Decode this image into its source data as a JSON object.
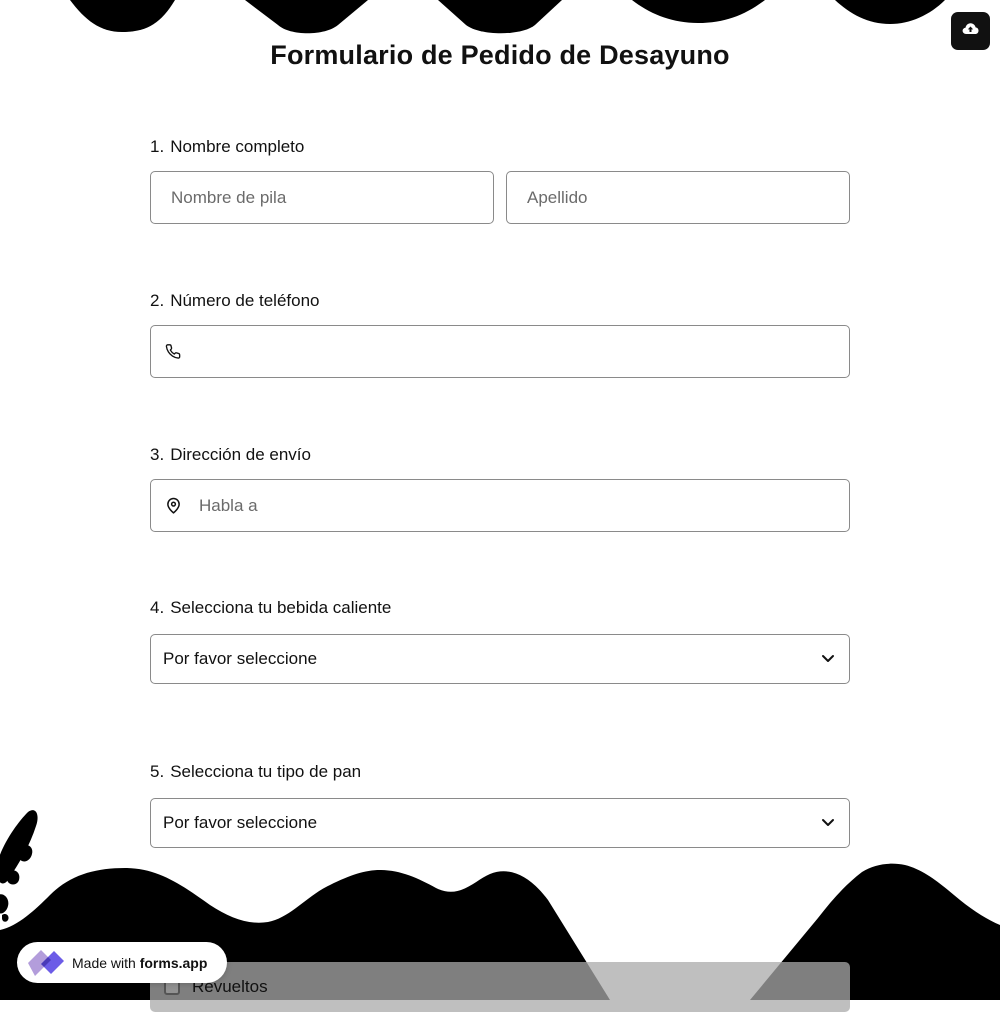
{
  "form": {
    "title": "Formulario de Pedido de Desayuno",
    "questions": [
      {
        "number": "1.",
        "label": "Nombre completo",
        "first_name_placeholder": "Nombre de pila",
        "last_name_placeholder": "Apellido"
      },
      {
        "number": "2.",
        "label": "Número de teléfono",
        "icon": "phone-icon",
        "placeholder": ""
      },
      {
        "number": "3.",
        "label": "Dirección de envío",
        "icon": "location-pin-icon",
        "placeholder": "Habla a"
      },
      {
        "number": "4.",
        "label": "Selecciona tu bebida caliente",
        "selected": "Por favor seleccione",
        "icon": "chevron-down-icon"
      },
      {
        "number": "5.",
        "label": "Selecciona tu tipo de pan",
        "selected": "Por favor seleccione",
        "icon": "chevron-down-icon"
      }
    ],
    "partial_option": {
      "label": "Revueltos"
    }
  },
  "toolbar": {
    "upload_icon": "cloud-upload-icon"
  },
  "badge": {
    "prefix": "Made with",
    "brand": "forms.app",
    "icon": "forms-app-logo"
  },
  "colors": {
    "background": "#ffffff",
    "decoration": "#000000",
    "text": "#111111",
    "border": "#8a8a8a",
    "placeholder": "#6b6b6b",
    "logo_purple": "#6c5ce7"
  }
}
